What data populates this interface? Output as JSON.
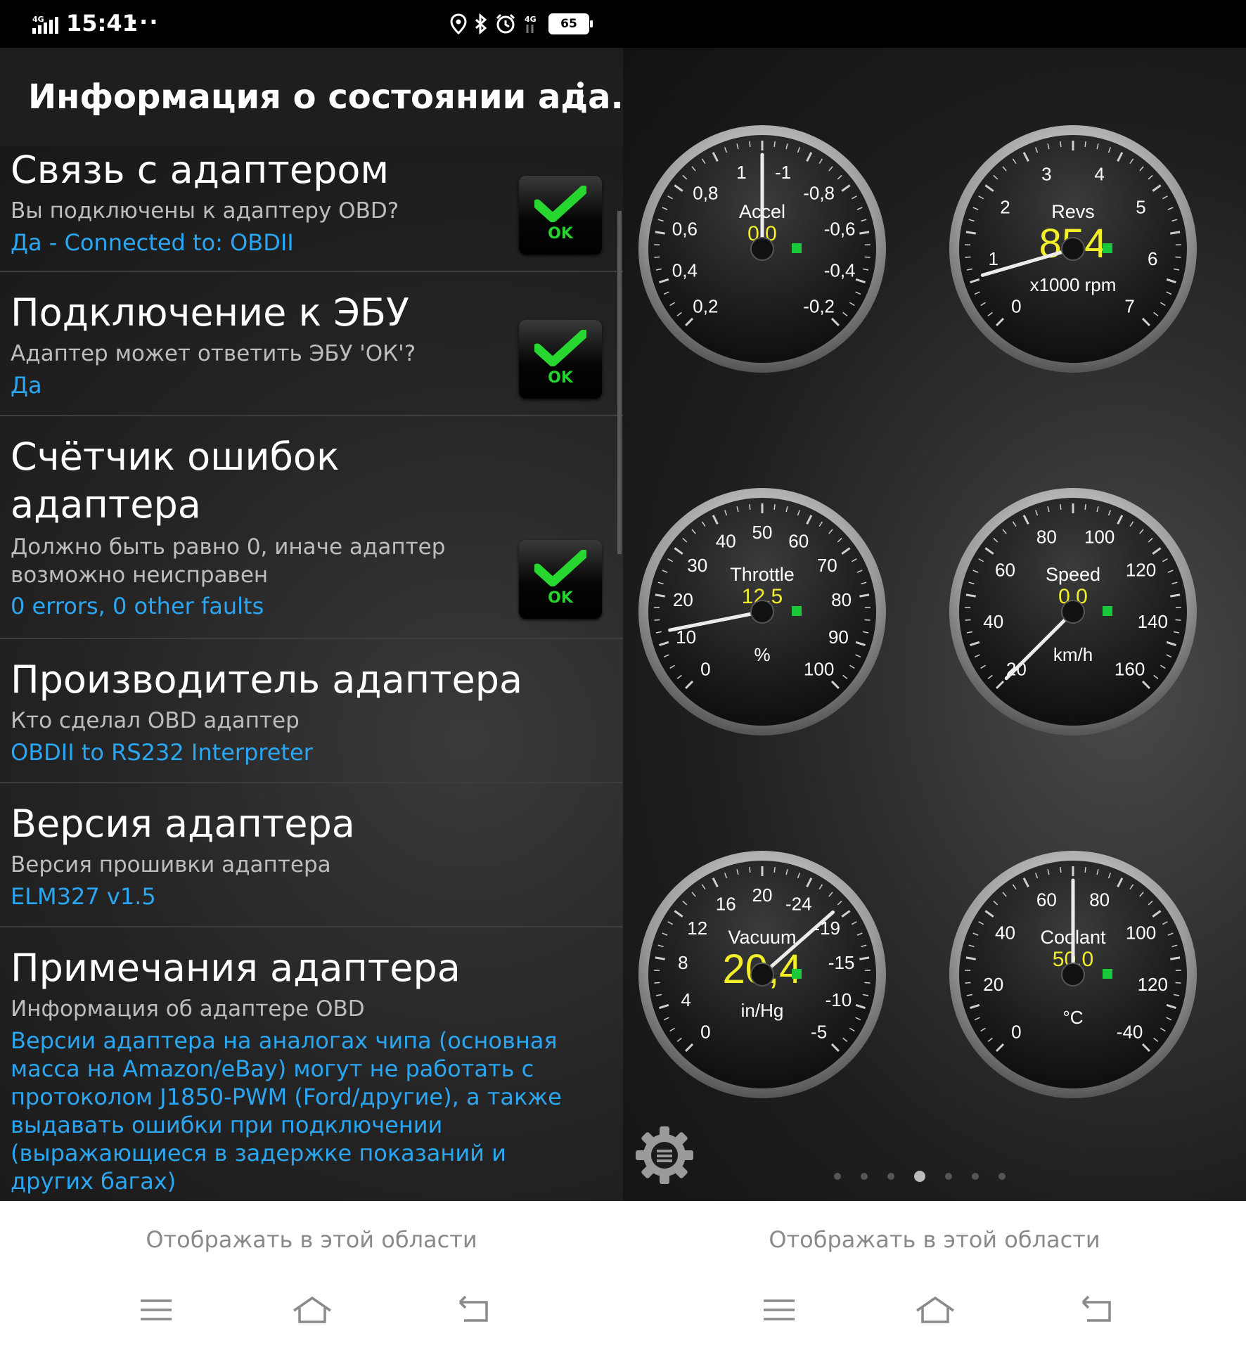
{
  "status_bar": {
    "network": "4G",
    "time": "15:41",
    "more_indicator": "···",
    "battery": "65",
    "icons": [
      "location-icon",
      "bluetooth-icon",
      "alarm-icon",
      "4g-icon",
      "battery-icon"
    ]
  },
  "left_pane": {
    "title": "Информация о состоянии ада...",
    "items": [
      {
        "heading": "Связь с адаптером",
        "subtitle": "Вы подключены к адаптеру OBD?",
        "value": "Да - Connected to: OBDII",
        "ok_label": "OK"
      },
      {
        "heading": "Подключение к ЭБУ",
        "subtitle": "Адаптер может ответить ЭБУ 'ОК'?",
        "value": "Да",
        "ok_label": "OK"
      },
      {
        "heading": "Счётчик ошибок адаптера",
        "subtitle": "Должно быть равно 0, иначе адаптер возможно неисправен",
        "value": "0 errors, 0 other faults",
        "ok_label": "OK"
      },
      {
        "heading": "Производитель адаптера",
        "subtitle": "Кто сделал OBD адаптер",
        "value": "OBDII to RS232 Interpreter"
      },
      {
        "heading": "Версия адаптера",
        "subtitle": "Версия прошивки адаптера",
        "value": "ELM327 v1.5"
      },
      {
        "heading": "Примечания адаптера",
        "subtitle": "Информация об адаптере OBD",
        "value": "Версии адаптера на аналогах чипа (основная масса на Amazon/eBay) могут не работать с протоколом J1850-PWM (Ford/другие), а также выдавать ошибки при подключении (выражающиеся в задержке показаний и других багах)"
      }
    ]
  },
  "gauges": [
    {
      "name": "Accel",
      "value": "0,0",
      "unit": "",
      "ticks": [
        "0,2",
        "0,4",
        "0,6",
        "0,8",
        "1",
        "-1",
        "-0,8",
        "-0,6",
        "-0,4",
        "-0,2"
      ],
      "value_num": 0,
      "min": -1,
      "max": 1
    },
    {
      "name": "Revs",
      "value": "854",
      "unit": "x1000 rpm",
      "ticks": [
        "1",
        "2",
        "3",
        "4",
        "5",
        "6",
        "7"
      ],
      "zero": "0",
      "value_num": 0.854,
      "min": 0,
      "max": 8
    },
    {
      "name": "Throttle",
      "value": "12,5",
      "unit": "%",
      "ticks": [
        "10",
        "20",
        "30",
        "40",
        "50",
        "60",
        "70",
        "80",
        "90",
        "100"
      ],
      "zero": "0",
      "value_num": 12.5,
      "min": 0,
      "max": 100
    },
    {
      "name": "Speed",
      "value": "0,0",
      "unit": "km/h",
      "ticks": [
        "20",
        "40",
        "60",
        "80",
        "100",
        "120",
        "140",
        "160"
      ],
      "value_num": 0,
      "min": 0,
      "max": 180
    },
    {
      "name": "Vacuum",
      "value": "20,4",
      "unit": "in/Hg",
      "ticks": [
        "4",
        "8",
        "12",
        "16",
        "20",
        "-24",
        "-19",
        "-15",
        "-10",
        "-5"
      ],
      "zero": "0",
      "value_num": 20.4,
      "min": 0,
      "max": 30
    },
    {
      "name": "Coolant",
      "value": "50,0",
      "unit": "°C",
      "ticks": [
        "20",
        "40",
        "60",
        "80",
        "100",
        "120",
        "-40"
      ],
      "zero": "0",
      "value_num": 50,
      "min": -40,
      "max": 140
    }
  ],
  "pager": {
    "count": 7,
    "active": 3
  },
  "bottom_bar": {
    "hint_left": "Отображать в этой области",
    "hint_right": "Отображать в этой области"
  },
  "colors": {
    "accent_blue": "#2aa6f2",
    "ok_green": "#26d22e",
    "gauge_value_yellow": "#f2ee2a"
  }
}
